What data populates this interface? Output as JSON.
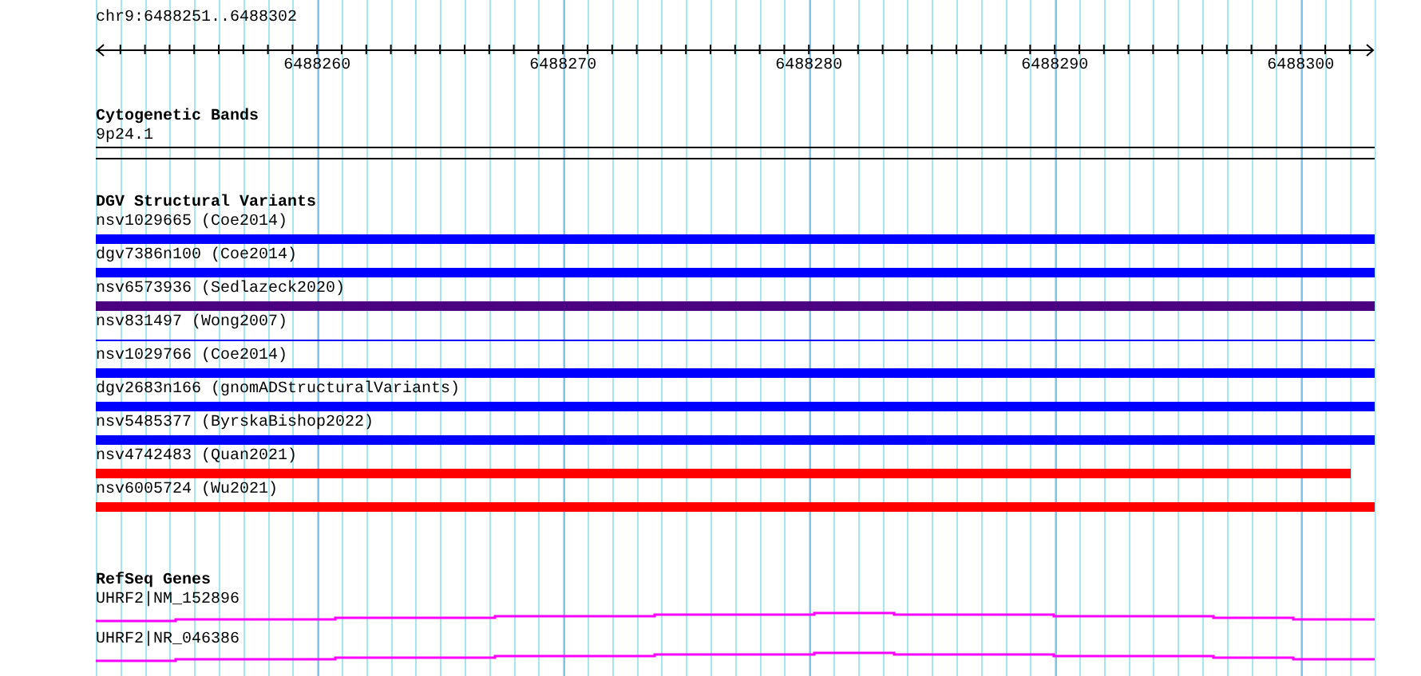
{
  "ruler": {
    "region": "chr9:6488251..6488302",
    "tick_labels": [
      "6488260",
      "6488270",
      "6488280",
      "6488290",
      "6488300"
    ]
  },
  "tracks": [
    {
      "title": "Cytogenetic Bands",
      "kind": "band",
      "features": [
        {
          "label": "9p24.1"
        }
      ]
    },
    {
      "title": "DGV Structural Variants",
      "kind": "variants",
      "features": [
        {
          "label": "nsv1029665 (Coe2014)",
          "color": "#0000ff",
          "kind": "thick",
          "truncated": false
        },
        {
          "label": "dgv7386n100 (Coe2014)",
          "color": "#0000ff",
          "kind": "thick",
          "truncated": false
        },
        {
          "label": "nsv6573936 (Sedlazeck2020)",
          "color": "#4b0082",
          "kind": "thick",
          "truncated": false
        },
        {
          "label": "nsv831497 (Wong2007)",
          "color": "#0000ff",
          "kind": "thin",
          "truncated": false
        },
        {
          "label": "nsv1029766 (Coe2014)",
          "color": "#0000ff",
          "kind": "thick",
          "truncated": false
        },
        {
          "label": "dgv2683n166 (gnomADStructuralVariants)",
          "color": "#0000ff",
          "kind": "thick",
          "truncated": false
        },
        {
          "label": "nsv5485377 (ByrskaBishop2022)",
          "color": "#0000ff",
          "kind": "thick",
          "truncated": false
        },
        {
          "label": "nsv4742483 (Quan2021)",
          "color": "#ff0000",
          "kind": "thick",
          "truncated": true
        },
        {
          "label": "nsv6005724 (Wu2021)",
          "color": "#ff0000",
          "kind": "thick",
          "truncated": false
        }
      ]
    },
    {
      "title": "RefSeq Genes",
      "kind": "genes",
      "features": [
        {
          "label": "UHRF2|NM_152896"
        },
        {
          "label": "UHRF2|NR_046386"
        }
      ]
    }
  ]
}
